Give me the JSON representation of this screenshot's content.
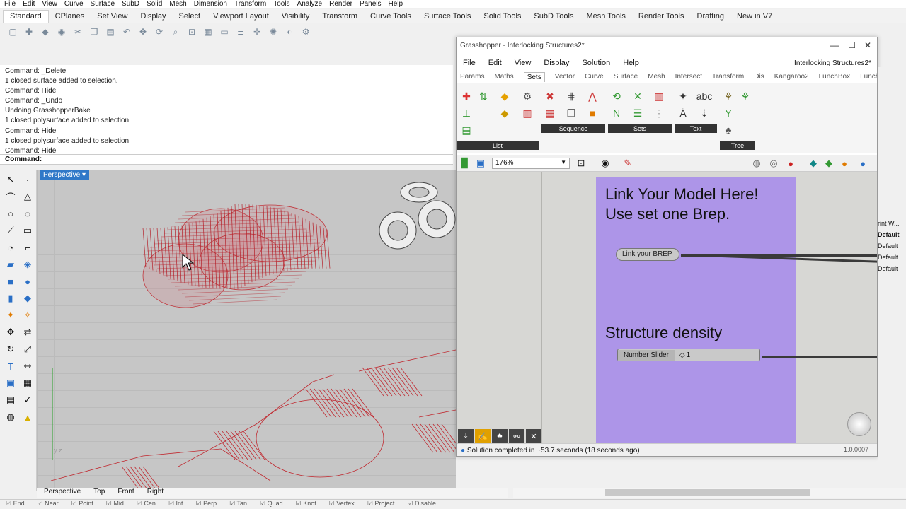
{
  "menubar": [
    "File",
    "Edit",
    "View",
    "Curve",
    "Surface",
    "SubD",
    "Solid",
    "Mesh",
    "Dimension",
    "Transform",
    "Tools",
    "Analyze",
    "Render",
    "Panels",
    "Help"
  ],
  "tabs": [
    "Standard",
    "CPlanes",
    "Set View",
    "Display",
    "Select",
    "Viewport Layout",
    "Visibility",
    "Transform",
    "Curve Tools",
    "Surface Tools",
    "Solid Tools",
    "SubD Tools",
    "Mesh Tools",
    "Render Tools",
    "Drafting",
    "New in V7"
  ],
  "active_tab": "Standard",
  "command_history": [
    "Command: _Delete",
    "1 closed surface added to selection.",
    "Command: Hide",
    "Command: _Undo",
    "Undoing GrasshopperBake",
    "1 closed polysurface added to selection.",
    "Command: Hide",
    "1 closed polysurface added to selection.",
    "Command: Hide"
  ],
  "command_prompt": "Command:",
  "viewport": {
    "title": "Perspective",
    "tabs": [
      "Perspective",
      "Top",
      "Front",
      "Right"
    ],
    "axis_label": "y z"
  },
  "statusbar": [
    "End",
    "Near",
    "Point",
    "Mid",
    "Cen",
    "Int",
    "Perp",
    "Tan",
    "Quad",
    "Knot",
    "Vertex",
    "Project",
    "Disable"
  ],
  "grasshopper": {
    "title": "Grasshopper - Interlocking Structures2*",
    "document": "Interlocking Structures2*",
    "menu": [
      "File",
      "Edit",
      "View",
      "Display",
      "Solution",
      "Help"
    ],
    "categories": [
      "Params",
      "Maths",
      "Sets",
      "Vector",
      "Curve",
      "Surface",
      "Mesh",
      "Intersect",
      "Transform",
      "Dis",
      "Kangaroo2",
      "LunchBox",
      "LunchBoxML"
    ],
    "active_category": "Sets",
    "ribbon_groups": [
      "List",
      "Sequence",
      "Sets",
      "Text",
      "Tree"
    ],
    "zoom": "176%",
    "group_line1": "Link Your Model Here!",
    "group_line2": "Use set one Brep.",
    "param_label": "Link your BREP",
    "density_title": "Structure density",
    "slider_label": "Number Slider",
    "slider_value": "1",
    "status": "Solution completed in ~53.7 seconds (18 seconds ago)",
    "version": "1.0.0007"
  },
  "right_panel": [
    "rint W...",
    "Default",
    "Default",
    "Default",
    "Default"
  ]
}
